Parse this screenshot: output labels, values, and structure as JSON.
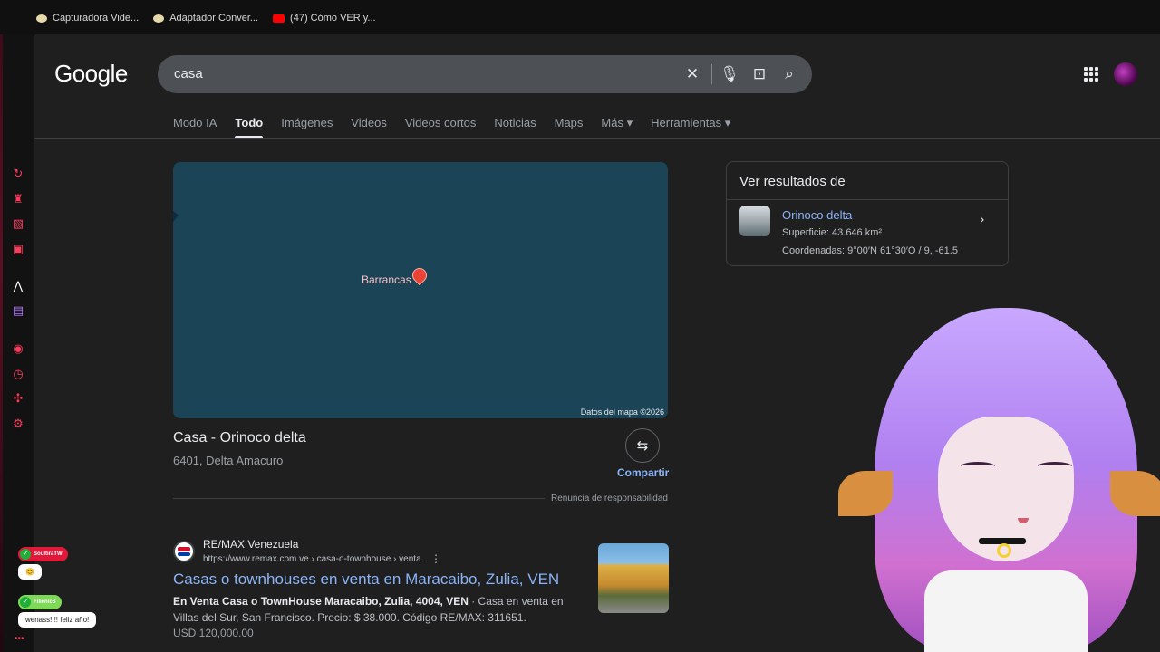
{
  "browser": {
    "bookmarks": [
      {
        "label": "Capturadora Vide...",
        "icon": "bookmark-icon"
      },
      {
        "label": "Adaptador Conver...",
        "icon": "bookmark-icon"
      },
      {
        "label": "(47) Cómo VER y...",
        "icon": "youtube-icon"
      }
    ]
  },
  "google": {
    "logo": "Google",
    "search": {
      "value": "casa"
    },
    "tabs": [
      "Modo IA",
      "Todo",
      "Imágenes",
      "Videos",
      "Videos cortos",
      "Noticias",
      "Maps",
      "Más ▾",
      "Herramientas ▾"
    ],
    "active_tab": "Todo"
  },
  "map": {
    "label": "Barrancas",
    "credit": "Datos del mapa ©2026",
    "place_title": "Casa - Orinoco delta",
    "place_subtitle": "6401, Delta Amacuro",
    "share_label": "Compartir",
    "disclaimer": "Renuncia de responsabilidad"
  },
  "result": {
    "site_name": "RE/MAX Venezuela",
    "url": "https://www.remax.com.ve › casa-o-townhouse › venta",
    "title": "Casas o townhouses en venta en Maracaibo, Zulia, VEN",
    "snippet_bold": "En Venta Casa o TownHouse Maracaibo, Zulia, 4004, VEN",
    "snippet_rest": " · Casa en venta en Villas del Sur, San Francisco. Precio: $ 38.000. Código RE/MAX: 311651.",
    "price": "USD 120,000.00"
  },
  "knowledge_panel": {
    "heading": "Ver resultados de",
    "name": "Orinoco delta",
    "detail1": "Superficie: 43.646 km²",
    "detail2": "Coordenadas: 9°00′N 61°30′O / 9, -61.5"
  },
  "chat": [
    {
      "user": "SoultiraTW",
      "message": "😊",
      "color": "#e0193a"
    },
    {
      "user": "FilienicS",
      "message": "wenass!!!! feliz año!",
      "color": "#7ed957"
    }
  ]
}
